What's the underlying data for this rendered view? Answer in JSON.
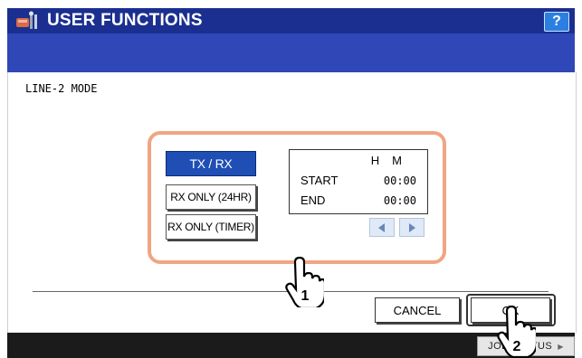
{
  "header": {
    "title": "USER FUNCTIONS",
    "help_label": "?",
    "icon": "user-functions-icon"
  },
  "page": {
    "mode_label": "LINE-2 MODE"
  },
  "mode_buttons": [
    {
      "label": "TX / RX",
      "selected": true
    },
    {
      "label": "RX ONLY (24HR)",
      "selected": false
    },
    {
      "label": "RX ONLY (TIMER)",
      "selected": false
    }
  ],
  "timer": {
    "col_h": "H",
    "col_m": "M",
    "start_label": "START",
    "start_value": "00:00",
    "end_label": "END",
    "end_value": "00:00"
  },
  "nav": {
    "left_icon": "arrow-left-icon",
    "right_icon": "arrow-right-icon"
  },
  "actions": {
    "cancel_label": "CANCEL",
    "ok_label": "OK"
  },
  "footer": {
    "job_status_label": "JOB STATUS"
  },
  "callouts": {
    "step1": "1",
    "step2": "2"
  },
  "colors": {
    "title_bar": "#1a2f8f",
    "band": "#3047b8",
    "selected_button": "#1f4fb5",
    "highlight": "#f0a583"
  }
}
